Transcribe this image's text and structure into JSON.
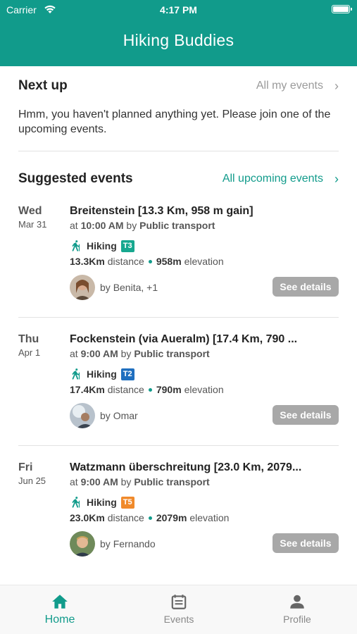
{
  "status_bar": {
    "carrier": "Carrier",
    "time": "4:17 PM"
  },
  "header": {
    "title": "Hiking Buddies"
  },
  "next_up": {
    "title": "Next up",
    "link": "All my events",
    "message": "Hmm, you haven't planned anything yet. Please join one of the upcoming events."
  },
  "suggested": {
    "title": "Suggested events",
    "link": "All upcoming events",
    "events": [
      {
        "dow": "Wed",
        "date": "Mar 31",
        "title": "Breitenstein [13.3 Km, 958 m gain]",
        "time": "10:00 AM",
        "transport": "Public transport",
        "activity": "Hiking",
        "grade": "T3",
        "grade_color": "#17a88f",
        "distance": "13.3Km",
        "elevation": "958m",
        "by": "Benita, +1",
        "button": "See details"
      },
      {
        "dow": "Thu",
        "date": "Apr 1",
        "title": "Fockenstein (via Aueralm) [17.4 Km, 790 ...",
        "time": "9:00 AM",
        "transport": "Public transport",
        "activity": "Hiking",
        "grade": "T2",
        "grade_color": "#1f6fbf",
        "distance": "17.4Km",
        "elevation": "790m",
        "by": "Omar",
        "button": "See details"
      },
      {
        "dow": "Fri",
        "date": "Jun 25",
        "title": "Watzmann überschreitung [23.0 Km, 2079...",
        "time": "9:00 AM",
        "transport": "Public transport",
        "activity": "Hiking",
        "grade": "T5",
        "grade_color": "#f08a2b",
        "distance": "23.0Km",
        "elevation": "2079m",
        "by": "Fernando",
        "button": "See details"
      }
    ]
  },
  "labels": {
    "at": "at",
    "by": "by",
    "distance": "distance",
    "elevation": "elevation"
  },
  "tabs": [
    {
      "label": "Home",
      "icon": "home-icon",
      "active": true
    },
    {
      "label": "Events",
      "icon": "calendar-icon",
      "active": false
    },
    {
      "label": "Profile",
      "icon": "person-icon",
      "active": false
    }
  ],
  "colors": {
    "accent": "#119b8b",
    "button_grey": "#a8a8a8"
  }
}
